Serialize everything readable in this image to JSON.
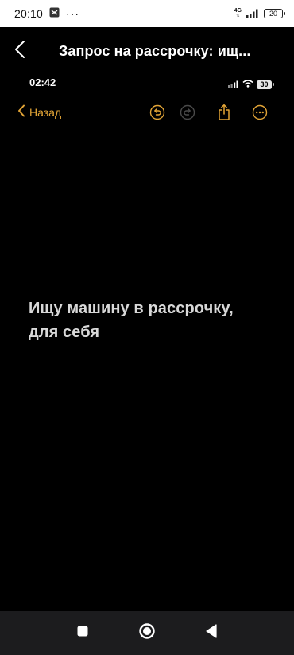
{
  "status_bar": {
    "time": "20:10",
    "network": "4G",
    "battery": "20"
  },
  "header": {
    "title": "Запрос на рассрочку: ищ..."
  },
  "embedded": {
    "status": {
      "time": "02:42",
      "battery": "30"
    },
    "toolbar": {
      "back_label": "Назад",
      "accent_color": "#e2a436"
    },
    "note": {
      "text_line1": "Ищу машину в рассрочку,",
      "text_line2": "для себя"
    }
  },
  "nav_bar": {
    "buttons": [
      "recents",
      "home",
      "back"
    ]
  }
}
